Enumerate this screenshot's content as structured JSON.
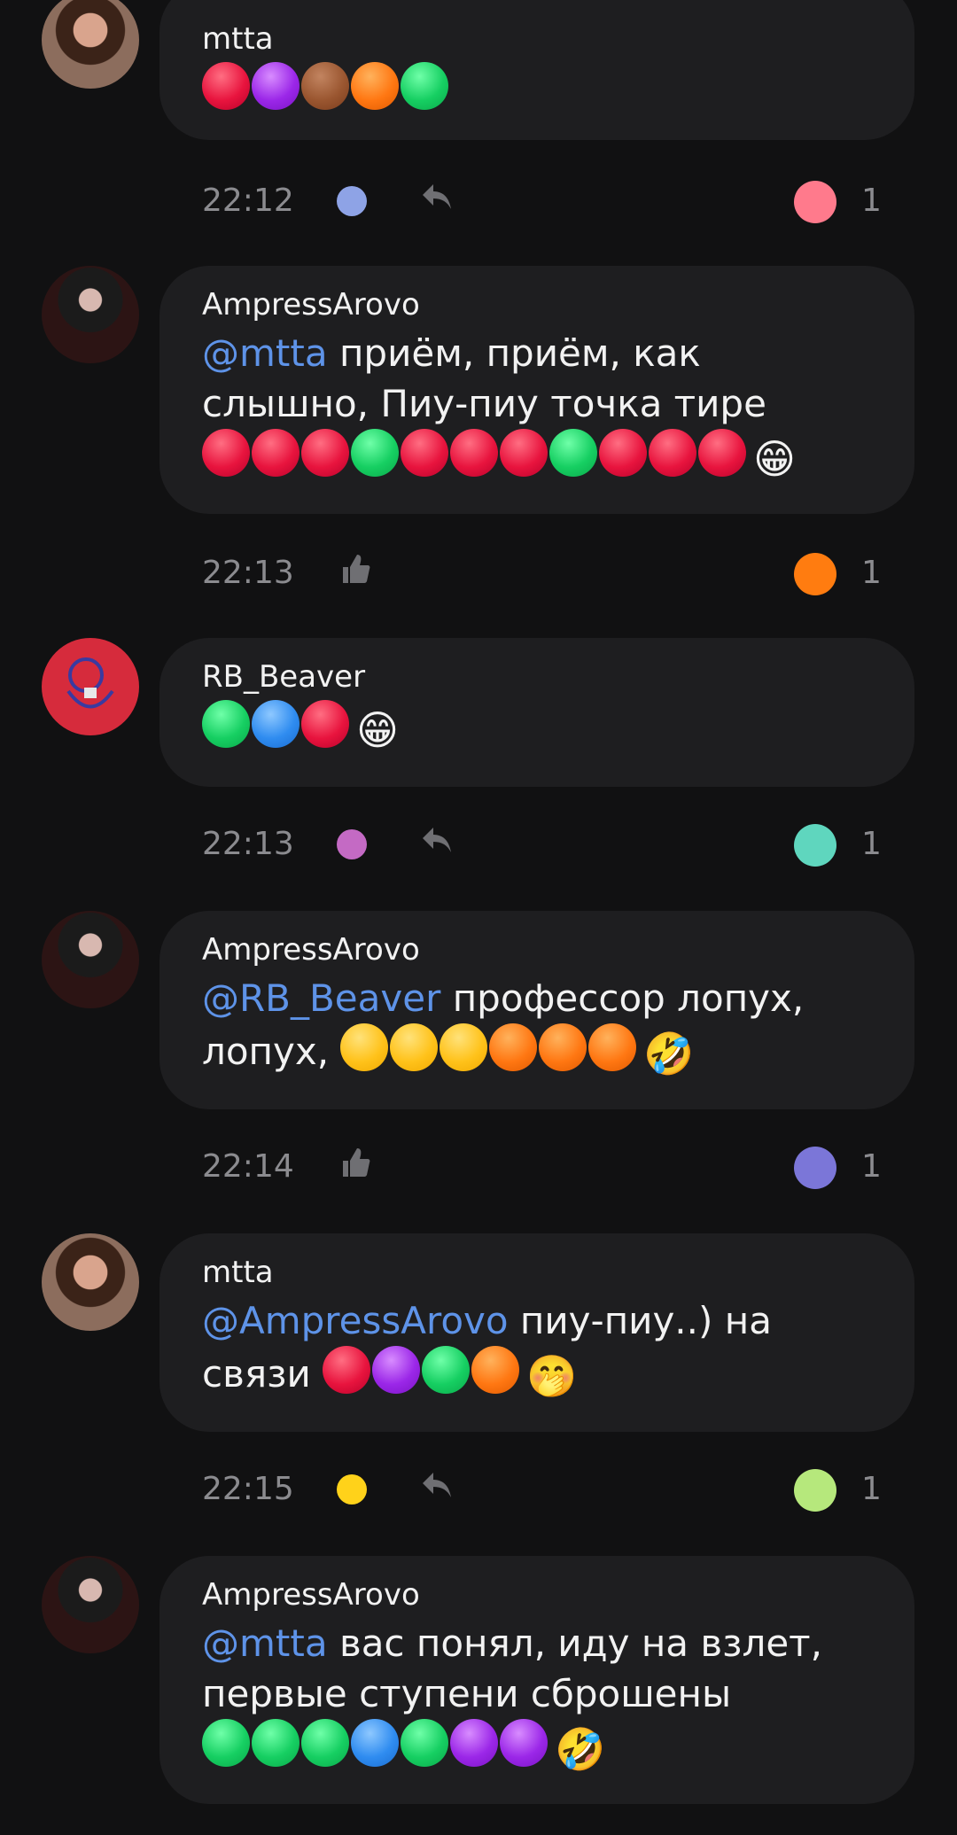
{
  "messages": [
    {
      "author": "mtta",
      "mention": "",
      "text": "",
      "dots": [
        "red",
        "purple",
        "brown",
        "orange",
        "green"
      ],
      "emoji": "",
      "time": "22:12",
      "status_dot_color": "#8ea3e6",
      "action": "reply",
      "reaction_color": "#ff7a8c",
      "reaction_count": "1"
    },
    {
      "author": "AmpressArovo",
      "mention": "@mtta",
      "text": " приём, приём, как слышно, Пиу-пиу  точка тире",
      "dots": [
        "red",
        "red",
        "red",
        "green",
        "red",
        "red",
        "red",
        "green",
        "red",
        "red",
        "red"
      ],
      "emoji": "😁",
      "time": "22:13",
      "status_dot_color": "",
      "action": "like",
      "reaction_color": "#ff7c10",
      "reaction_count": "1"
    },
    {
      "author": "RB_Beaver",
      "mention": "",
      "text": "",
      "dots": [
        "green",
        "blue",
        "red"
      ],
      "emoji": "😁",
      "time": "22:13",
      "status_dot_color": "#c46ac4",
      "action": "reply",
      "reaction_color": "#5fd6be",
      "reaction_count": "1"
    },
    {
      "author": "AmpressArovo",
      "mention": "@RB_Beaver",
      "text": " профессор лопух, лопух, ",
      "dots": [
        "yellow",
        "yellow",
        "yellow",
        "orange",
        "orange",
        "orange"
      ],
      "emoji": "🤣",
      "time": "22:14",
      "status_dot_color": "",
      "action": "like",
      "reaction_color": "#7b76d8",
      "reaction_count": "1"
    },
    {
      "author": "mtta",
      "mention": "@AmpressArovo",
      "text": " пиу-пиу..) на связи ",
      "dots": [
        "red",
        "purple",
        "green",
        "orange"
      ],
      "emoji": "🤭",
      "time": "22:15",
      "status_dot_color": "#ffd21a",
      "action": "reply",
      "reaction_color": "#b6e87c",
      "reaction_count": "1"
    },
    {
      "author": "AmpressArovo",
      "mention": "@mtta",
      "text": " вас понял, иду на взлет, первые ступени сброшены ",
      "dots": [
        "green",
        "green",
        "green",
        "blue",
        "green",
        "purple",
        "purple"
      ],
      "emoji": "🤣",
      "time": "",
      "status_dot_color": "",
      "action": "",
      "reaction_color": "",
      "reaction_count": ""
    }
  ],
  "icons": {
    "reply": "reply-icon",
    "like": "thumbs-up-icon"
  }
}
